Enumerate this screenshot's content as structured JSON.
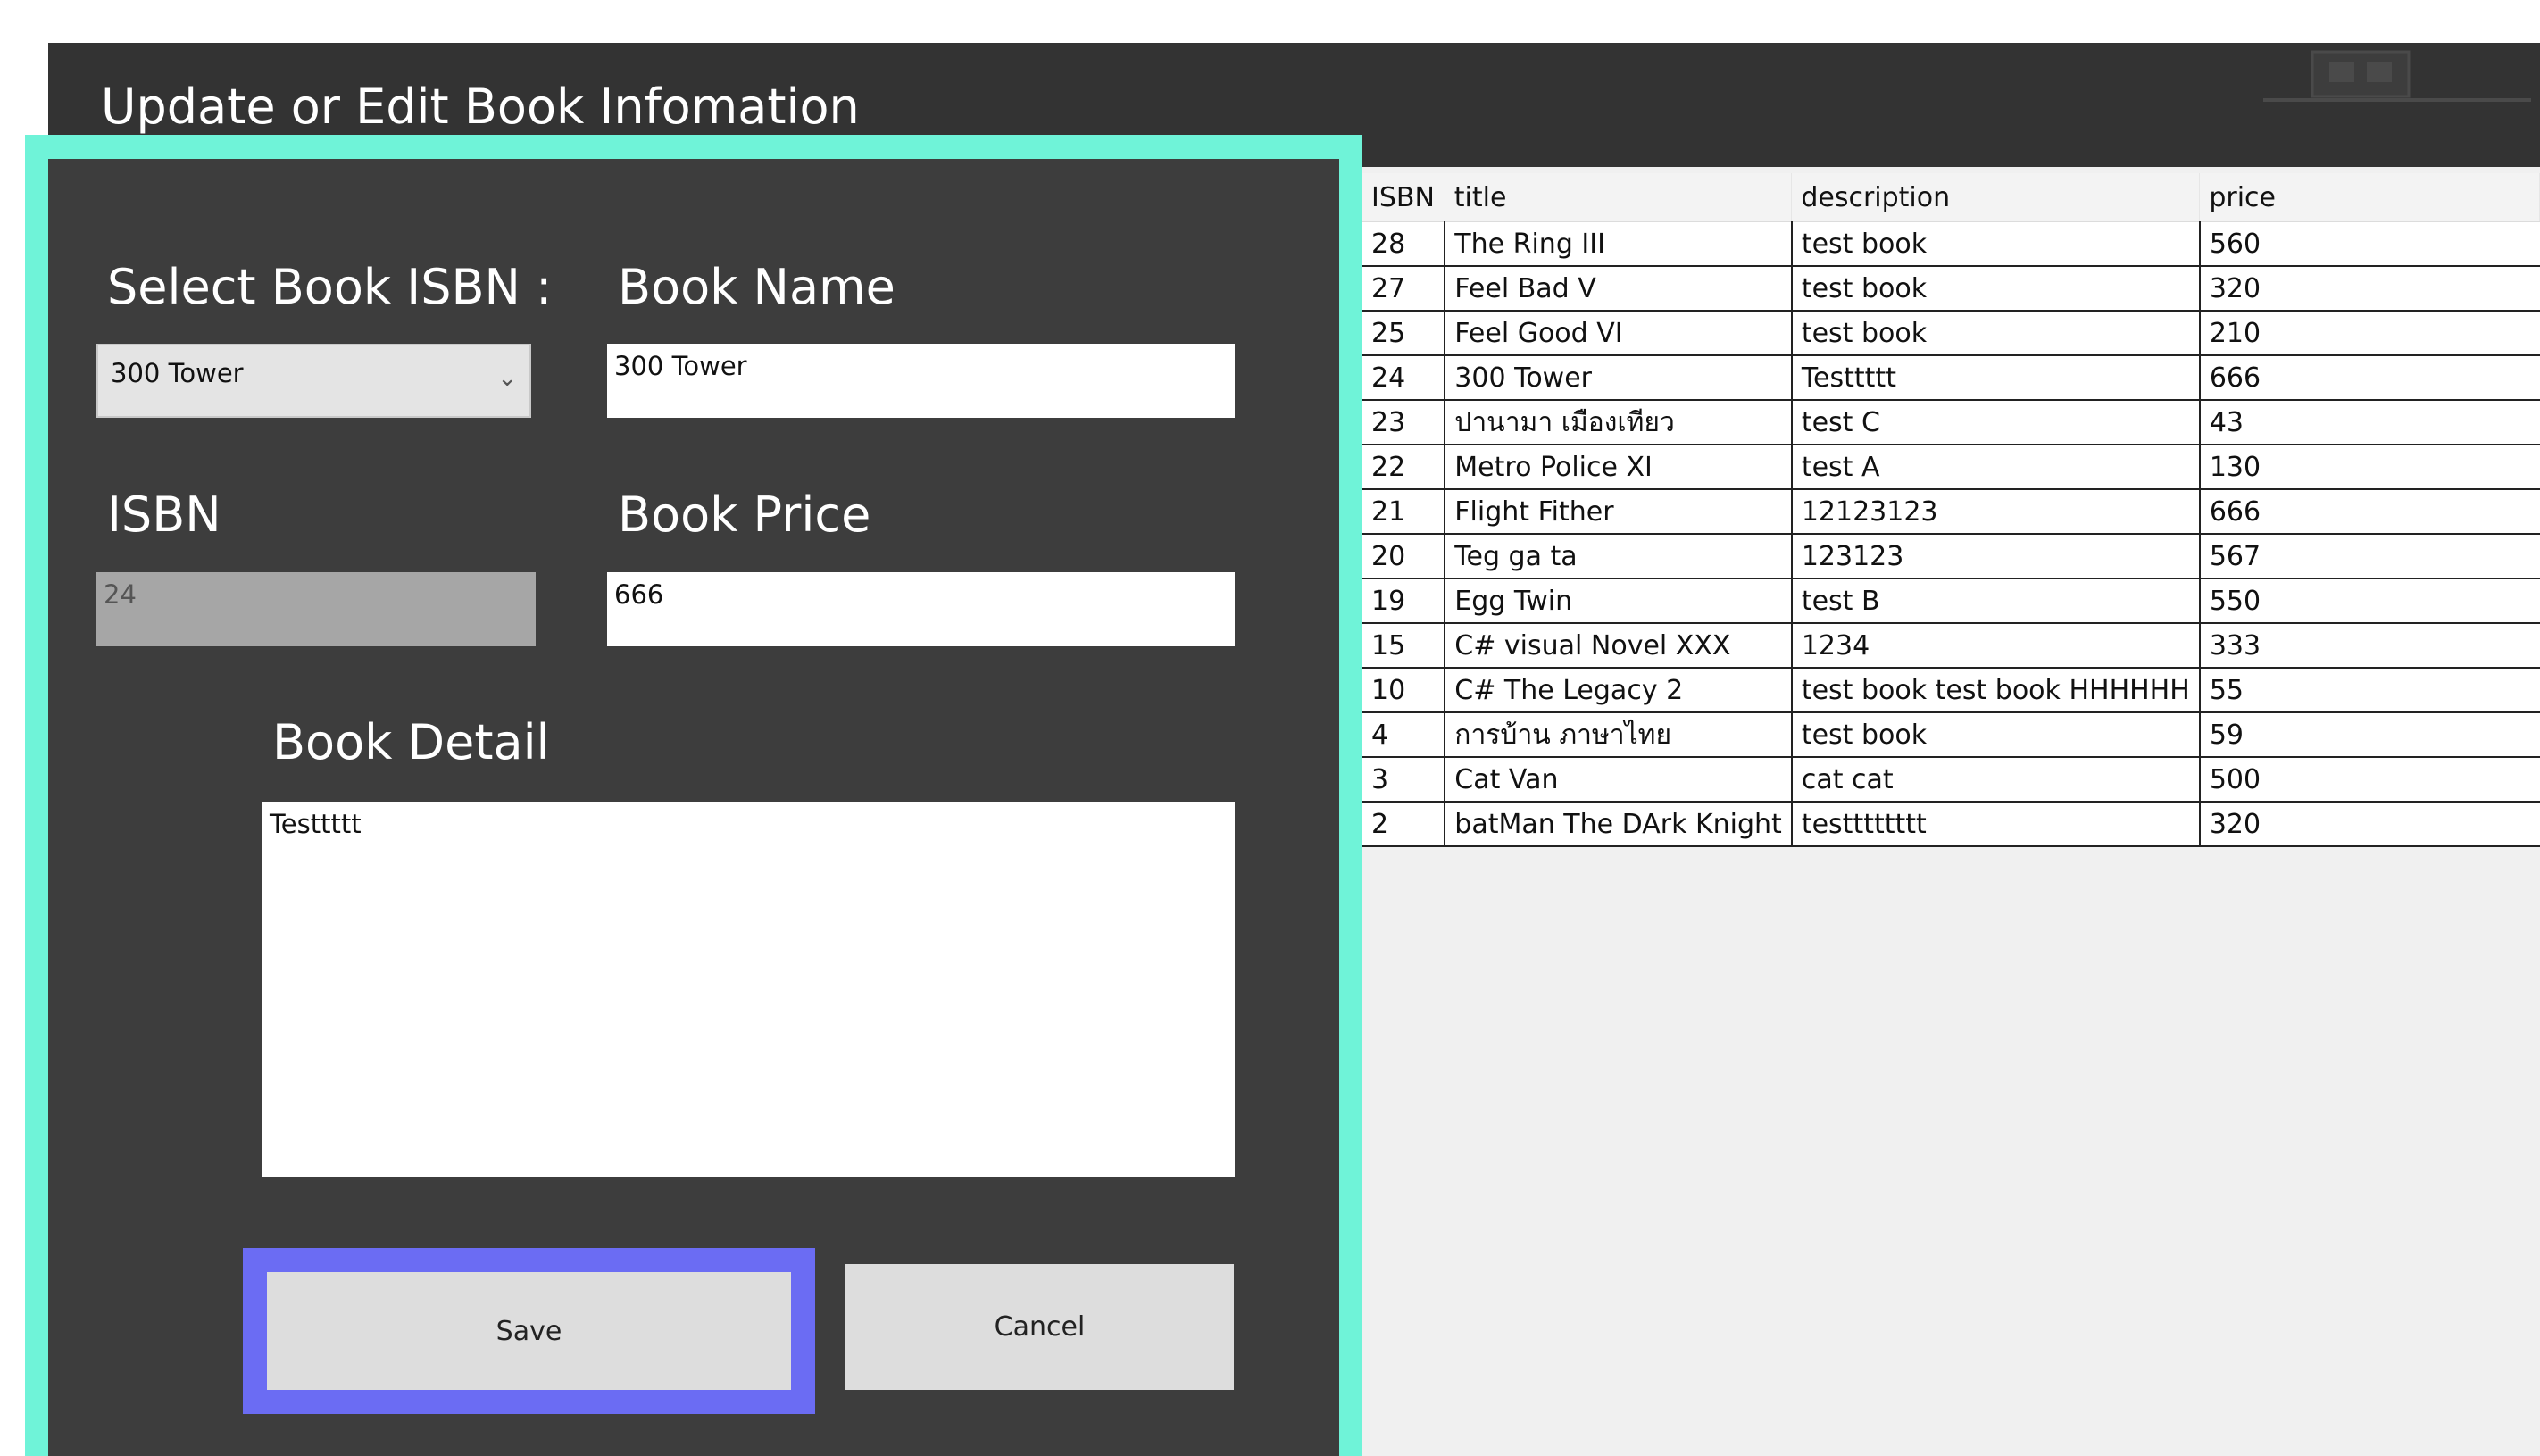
{
  "window": {
    "title": "Update or Edit Book Infomation"
  },
  "form": {
    "select_isbn_label": "Select Book ISBN :",
    "select_isbn_value": "300 Tower",
    "book_name_label": "Book Name",
    "book_name_value": "300 Tower",
    "isbn_label": "ISBN",
    "isbn_value": "24",
    "price_label": "Book Price",
    "price_value": "666",
    "detail_label": "Book Detail",
    "detail_value": "Testtttt",
    "save_label": "Save",
    "cancel_label": "Cancel"
  },
  "colors": {
    "panel_outline": "#6ff3d8",
    "save_focus": "#6b6cf3",
    "background": "#333333"
  },
  "table": {
    "columns": [
      "ISBN",
      "title",
      "description",
      "price"
    ],
    "rows": [
      [
        "28",
        "The Ring III",
        "test book",
        "560"
      ],
      [
        "27",
        "Feel Bad V",
        "test book",
        "320"
      ],
      [
        "25",
        "Feel Good VI",
        "test book",
        "210"
      ],
      [
        "24",
        "300 Tower",
        "Testtttt",
        "666"
      ],
      [
        "23",
        "ปานามา เมืองเทียว",
        "test C",
        "43"
      ],
      [
        "22",
        "Metro Police XI",
        "test A",
        "130"
      ],
      [
        "21",
        "Flight Fither",
        "12123123",
        "666"
      ],
      [
        "20",
        "Teg ga ta",
        "123123",
        "567"
      ],
      [
        "19",
        "Egg Twin",
        "test B",
        "550"
      ],
      [
        "15",
        "C# visual Novel XXX",
        "1234",
        "333"
      ],
      [
        "10",
        "C# The Legacy 2",
        "test book test book HHHHHH",
        "55"
      ],
      [
        "4",
        "การบ้าน ภาษาไทย",
        "test book",
        "59"
      ],
      [
        "3",
        "Cat Van",
        "cat cat",
        "500"
      ],
      [
        "2",
        "batMan The DArk Knight",
        "testttttttt",
        "320"
      ]
    ]
  }
}
